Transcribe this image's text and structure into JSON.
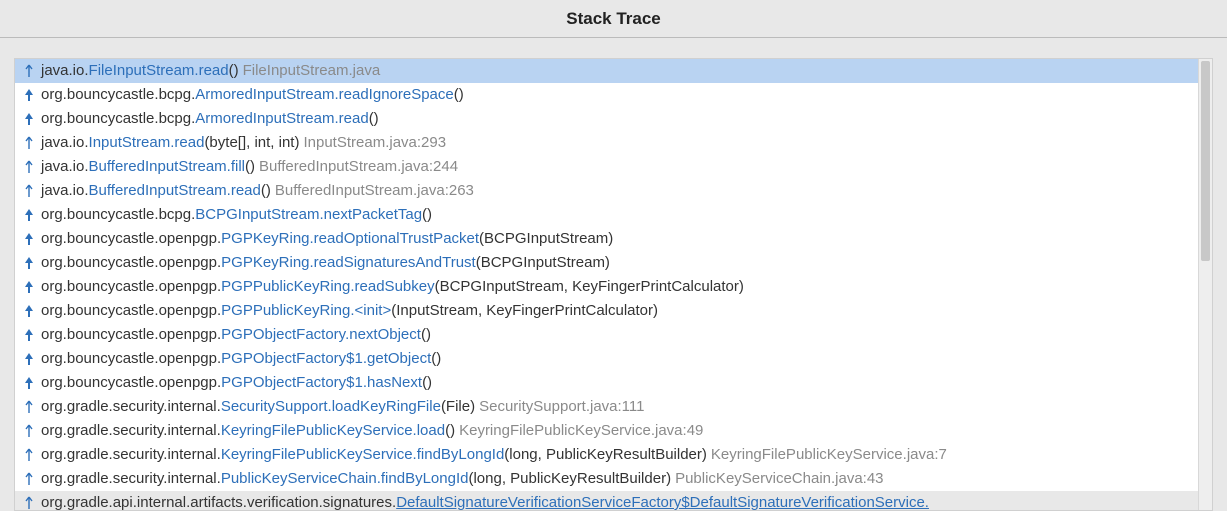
{
  "title": "Stack Trace",
  "frames": [
    {
      "arrow": "outlined",
      "selected": true,
      "pkg": "java.io.",
      "method": "FileInputStream.read",
      "params": "()",
      "source": "FileInputStream.java",
      "underlined": false,
      "cutoff": false
    },
    {
      "arrow": "filled",
      "selected": false,
      "pkg": "org.bouncycastle.bcpg.",
      "method": "ArmoredInputStream.readIgnoreSpace",
      "params": "()",
      "source": "",
      "underlined": false,
      "cutoff": false
    },
    {
      "arrow": "filled",
      "selected": false,
      "pkg": "org.bouncycastle.bcpg.",
      "method": "ArmoredInputStream.read",
      "params": "()",
      "source": "",
      "underlined": false,
      "cutoff": false
    },
    {
      "arrow": "outlined",
      "selected": false,
      "pkg": "java.io.",
      "method": "InputStream.read",
      "params": "(byte[], int, int)",
      "source": "InputStream.java:293",
      "underlined": false,
      "cutoff": false
    },
    {
      "arrow": "outlined",
      "selected": false,
      "pkg": "java.io.",
      "method": "BufferedInputStream.fill",
      "params": "()",
      "source": "BufferedInputStream.java:244",
      "underlined": false,
      "cutoff": false
    },
    {
      "arrow": "outlined",
      "selected": false,
      "pkg": "java.io.",
      "method": "BufferedInputStream.read",
      "params": "()",
      "source": "BufferedInputStream.java:263",
      "underlined": false,
      "cutoff": false
    },
    {
      "arrow": "filled",
      "selected": false,
      "pkg": "org.bouncycastle.bcpg.",
      "method": "BCPGInputStream.nextPacketTag",
      "params": "()",
      "source": "",
      "underlined": false,
      "cutoff": false
    },
    {
      "arrow": "filled",
      "selected": false,
      "pkg": "org.bouncycastle.openpgp.",
      "method": "PGPKeyRing.readOptionalTrustPacket",
      "params": "(BCPGInputStream)",
      "source": "",
      "underlined": false,
      "cutoff": false
    },
    {
      "arrow": "filled",
      "selected": false,
      "pkg": "org.bouncycastle.openpgp.",
      "method": "PGPKeyRing.readSignaturesAndTrust",
      "params": "(BCPGInputStream)",
      "source": "",
      "underlined": false,
      "cutoff": false
    },
    {
      "arrow": "filled",
      "selected": false,
      "pkg": "org.bouncycastle.openpgp.",
      "method": "PGPPublicKeyRing.readSubkey",
      "params": "(BCPGInputStream, KeyFingerPrintCalculator)",
      "source": "",
      "underlined": false,
      "cutoff": false
    },
    {
      "arrow": "filled",
      "selected": false,
      "pkg": "org.bouncycastle.openpgp.",
      "method": "PGPPublicKeyRing.<init>",
      "params": "(InputStream, KeyFingerPrintCalculator)",
      "source": "",
      "underlined": false,
      "cutoff": false
    },
    {
      "arrow": "filled",
      "selected": false,
      "pkg": "org.bouncycastle.openpgp.",
      "method": "PGPObjectFactory.nextObject",
      "params": "()",
      "source": "",
      "underlined": false,
      "cutoff": false
    },
    {
      "arrow": "filled",
      "selected": false,
      "pkg": "org.bouncycastle.openpgp.",
      "method": "PGPObjectFactory$1.getObject",
      "params": "()",
      "source": "",
      "underlined": false,
      "cutoff": false
    },
    {
      "arrow": "filled",
      "selected": false,
      "pkg": "org.bouncycastle.openpgp.",
      "method": "PGPObjectFactory$1.hasNext",
      "params": "()",
      "source": "",
      "underlined": false,
      "cutoff": false
    },
    {
      "arrow": "outlined",
      "selected": false,
      "pkg": "org.gradle.security.internal.",
      "method": "SecuritySupport.loadKeyRingFile",
      "params": "(File)",
      "source": "SecuritySupport.java:111",
      "underlined": false,
      "cutoff": false
    },
    {
      "arrow": "outlined",
      "selected": false,
      "pkg": "org.gradle.security.internal.",
      "method": "KeyringFilePublicKeyService.load",
      "params": "()",
      "source": "KeyringFilePublicKeyService.java:49",
      "underlined": false,
      "cutoff": false
    },
    {
      "arrow": "outlined",
      "selected": false,
      "pkg": "org.gradle.security.internal.",
      "method": "KeyringFilePublicKeyService.findByLongId",
      "params": "(long, PublicKeyResultBuilder)",
      "source": "KeyringFilePublicKeyService.java:7",
      "underlined": false,
      "cutoff": false
    },
    {
      "arrow": "outlined",
      "selected": false,
      "pkg": "org.gradle.security.internal.",
      "method": "PublicKeyServiceChain.findByLongId",
      "params": "(long, PublicKeyResultBuilder)",
      "source": "PublicKeyServiceChain.java:43",
      "underlined": false,
      "cutoff": false
    },
    {
      "arrow": "outlined",
      "selected": false,
      "pkg": "org.gradle.api.internal.artifacts.verification.signatures.",
      "method": "DefaultSignatureVerificationServiceFactory$DefaultSignatureVerificationService.",
      "params": "",
      "source": "",
      "underlined": true,
      "cutoff": true
    }
  ]
}
